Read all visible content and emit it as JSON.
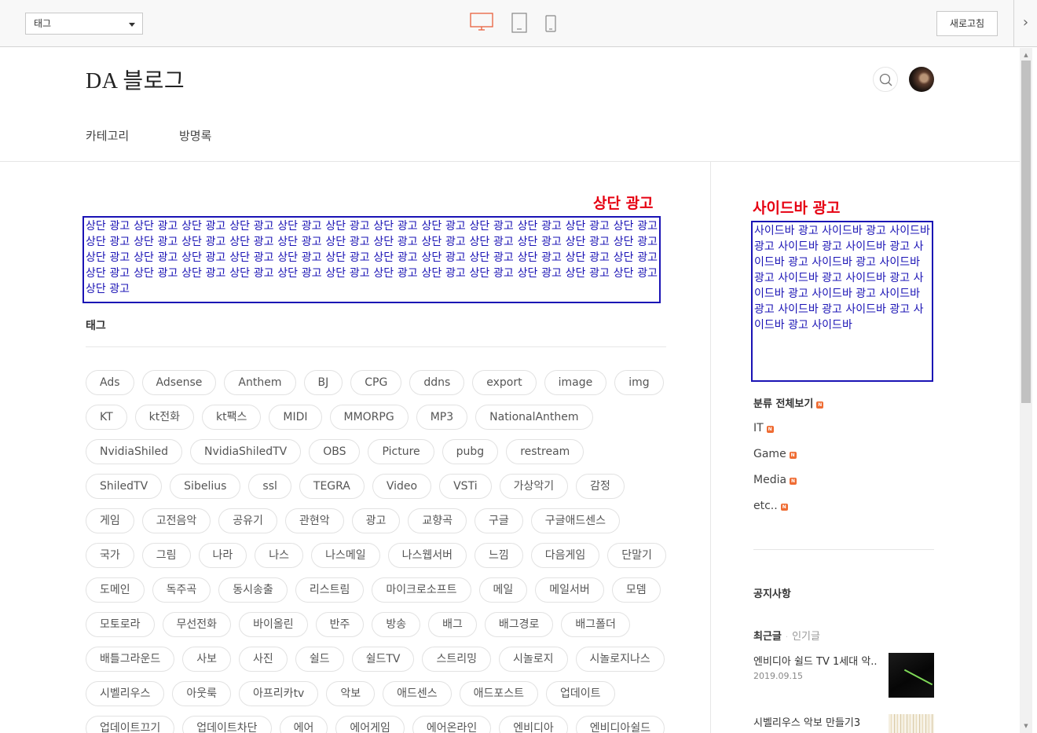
{
  "toolbar": {
    "page_select": "태그",
    "refresh_label": "새로고침"
  },
  "blog": {
    "title": "DA 블로그",
    "nav": [
      "카테고리",
      "방명록"
    ]
  },
  "top_ad": {
    "label": "상단 광고",
    "text": "상단 광고 상단 광고 상단 광고 상단 광고 상단 광고 상단 광고 상단 광고 상단 광고 상단 광고 상단 광고 상단 광고 상단 광고 상단 광고 상단 광고 상단 광고 상단 광고 상단 광고 상단 광고 상단 광고 상단 광고 상단 광고 상단 광고 상단 광고 상단 광고 상단 광고 상단 광고 상단 광고 상단 광고 상단 광고 상단 광고 상단 광고 상단 광고 상단 광고 상단 광고 상단 광고 상단 광고 상단 광고 상단 광고 상단 광고 상단 광고 상단 광고 상단 광고 상단 광고 상단 광고 상단 광고 상단 광고 상단 광고 상단 광고 상단 광고"
  },
  "tags_section": {
    "title": "태그",
    "tags": [
      "Ads",
      "Adsense",
      "Anthem",
      "BJ",
      "CPG",
      "ddns",
      "export",
      "image",
      "img",
      "KT",
      "kt전화",
      "kt팩스",
      "MIDI",
      "MMORPG",
      "MP3",
      "NationalAnthem",
      "NvidiaShiled",
      "NvidiaShiledTV",
      "OBS",
      "Picture",
      "pubg",
      "restream",
      "ShiledTV",
      "Sibelius",
      "ssl",
      "TEGRA",
      "Video",
      "VSTi",
      "가상악기",
      "감정",
      "게임",
      "고전음악",
      "공유기",
      "관현악",
      "광고",
      "교향곡",
      "구글",
      "구글애드센스",
      "국가",
      "그림",
      "나라",
      "나스",
      "나스메일",
      "나스웹서버",
      "느낌",
      "다음게임",
      "단말기",
      "도메인",
      "독주곡",
      "동시송출",
      "리스트림",
      "마이크로소프트",
      "메일",
      "메일서버",
      "모뎀",
      "모토로라",
      "무선전화",
      "바이올린",
      "반주",
      "방송",
      "배그",
      "배그경로",
      "배그폴더",
      "배틀그라운드",
      "사보",
      "사진",
      "쉴드",
      "쉴드TV",
      "스트리밍",
      "시놀로지",
      "시놀로지나스",
      "시벨리우스",
      "아웃룩",
      "아프리카tv",
      "악보",
      "애드센스",
      "애드포스트",
      "업데이트",
      "업데이트끄기",
      "업데이트차단",
      "에어",
      "에어게임",
      "에어온라인",
      "엔비디아",
      "엔비디아쉴드"
    ]
  },
  "sidebar_ad": {
    "label": "사이드바 광고",
    "text": "사이드바 광고 사이드바 광고 사이드바 광고 사이드바 광고 사이드바 광고 사이드바 광고 사이드바 광고 사이드바 광고 사이드바 광고 사이드바 광고 사이드바 광고 사이드바 광고 사이드바 광고 사이드바 광고 사이드바 광고 사이드바 광고 사이드바"
  },
  "categories": {
    "all_label": "분류 전체보기",
    "badge": "N",
    "items": [
      "IT",
      "Game",
      "Media",
      "etc.."
    ]
  },
  "notice": {
    "title": "공지사항"
  },
  "posts": {
    "tab_recent": "최근글",
    "tab_popular": "인기글",
    "items": [
      {
        "title": "엔비디아 쉴드 TV 1세대 악..",
        "date": "2019.09.15"
      },
      {
        "title": "시벨리우스 악보 만들기3",
        "date": ""
      }
    ]
  },
  "colors": {
    "ad_label": "#e60012",
    "ad_border": "#1a13b5",
    "device_active": "#e8603c",
    "new_badge": "#ef6c33"
  },
  "icons": {
    "device_desktop": "desktop-icon",
    "device_tablet": "tablet-icon",
    "device_mobile": "mobile-icon",
    "search": "search-icon",
    "panel_toggle": "chevron-right-icon"
  }
}
